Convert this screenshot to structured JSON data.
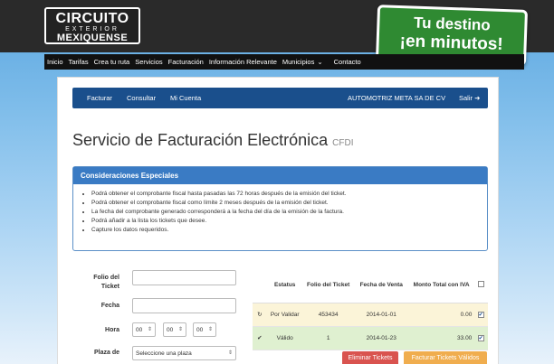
{
  "logo": {
    "line1": "CIRCUITO",
    "line2": "EXTERIOR",
    "line3": "MEXIQUENSE"
  },
  "badge": {
    "line1": "Tu destino",
    "line2": "¡en minutos!"
  },
  "nav": [
    "Inicio",
    "Tarifas",
    "Crea tu ruta",
    "Servicios",
    "Facturación",
    "Información Relevante",
    "Municipios",
    "Contacto"
  ],
  "nav_dropdown": "⌄",
  "subnav": {
    "facturar": "Facturar",
    "consultar": "Consultar",
    "cuenta": "Mi Cuenta",
    "company": "AUTOMOTRIZ META SA DE CV",
    "salir": "Salir"
  },
  "page": {
    "title": "Servicio de Facturación Electrónica",
    "subtitle": "CFDI"
  },
  "notice": {
    "title": "Consideraciones Especiales",
    "items": [
      "Podrá obtener el comprobante fiscal hasta pasadas las 72 horas después de la emisión del ticket.",
      "Podrá obtener el comprobante fiscal como límite 2 meses después de la emisión del ticket.",
      "La fecha del comprobante generado corresponderá a la fecha del día de la emisión de la factura.",
      "Podrá añadir a la lista los tickets que desee.",
      "Capture los datos requeridos."
    ]
  },
  "form": {
    "folio_label_1": "Folio del",
    "folio_label_2": "Ticket",
    "fecha_label": "Fecha",
    "hora_label": "Hora",
    "hora_values": [
      "00",
      "00",
      "00"
    ],
    "plaza_label": "Plaza de",
    "plaza_placeholder": "Seleccione una plaza",
    "folio_value": "",
    "fecha_value": ""
  },
  "table": {
    "headers": [
      "Estatus",
      "Folio del Ticket",
      "Fecha de Venta",
      "Monto Total con IVA"
    ],
    "rows": [
      {
        "status": "Por Validar",
        "folio": "453434",
        "fecha": "2014-01-01",
        "monto": "0.00"
      },
      {
        "status": "Válido",
        "folio": "1",
        "fecha": "2014-01-23",
        "monto": "33.00"
      }
    ]
  },
  "buttons": {
    "eliminar": "Eliminar Tickets",
    "facturar": "Facturar Tickets Válidos"
  }
}
